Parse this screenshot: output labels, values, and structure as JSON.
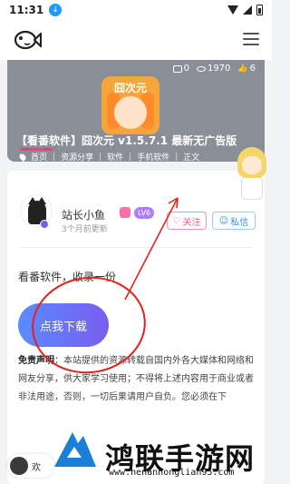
{
  "status_bar": {
    "time": "11:31"
  },
  "hero": {
    "stats": {
      "comments": "0",
      "views": "1970",
      "likes": "6"
    },
    "app_icon_text": "囧次元",
    "title": "【看番软件】囧次元 v1.5.7.1 最新无广告版",
    "breadcrumbs": [
      "首页",
      "资源分享",
      "软件",
      "手机软件",
      "正文"
    ]
  },
  "author": {
    "name": "站长小鱼",
    "level": "LV6",
    "time": "3个月前更新",
    "follow_label": "关注",
    "message_label": "私信"
  },
  "post": {
    "summary": "看番软件，收录一份",
    "download_label": "点我下载",
    "disclaimer_label": "免责声明",
    "disclaimer_text": "：本站提供的资源转载自国内外各大媒体和网络和网友分享，供大家学习使用；不得将上述内容用于商业或者非法用途，否则，一切后果请用户自负。您必须在下"
  },
  "welcome": {
    "label": "欢"
  },
  "watermark": {
    "brand": "鸿联手游网",
    "url": "www.henanhonglian95.com"
  },
  "colors": {
    "accent_pink": "#ff5c8a",
    "accent_blue": "#3a8ee6",
    "annotation_red": "#e0231c",
    "download_gradient_start": "#5a8cff",
    "download_gradient_end": "#7a5cf0"
  }
}
